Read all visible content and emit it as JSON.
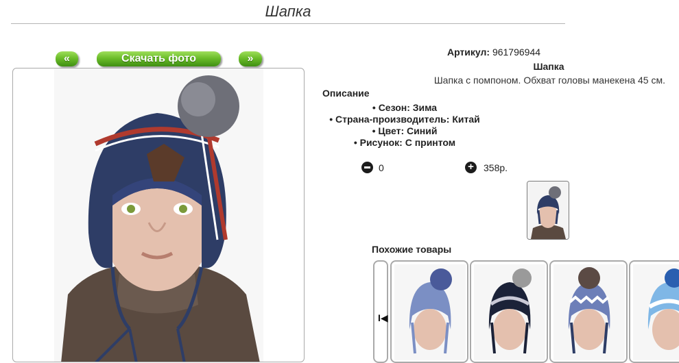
{
  "page": {
    "title": "Шапка"
  },
  "nav": {
    "prev_label": "«",
    "download_label": "Скачать фото",
    "next_label": "»"
  },
  "product": {
    "article_label": "Артикул:",
    "article_value": "961796944",
    "name": "Шапка",
    "short_description": "Шапка с помпоном. Обхват головы манекена 45 см.",
    "description_heading": "Описание",
    "properties": [
      "Сезон: Зима",
      "Страна-производитель: Китай",
      "Цвет: Синий",
      "Рисунок: С принтом"
    ],
    "quantity": "0",
    "price": "358р."
  },
  "similar": {
    "heading": "Похожие товары",
    "prev_arrow": "I◀"
  },
  "colors": {
    "accent_green": "#6cbd2a",
    "hat_navy": "#2e3d66",
    "stripe_red": "#b03a2e"
  },
  "icons": {
    "minus": "minus-circle-icon",
    "plus": "plus-circle-icon"
  }
}
